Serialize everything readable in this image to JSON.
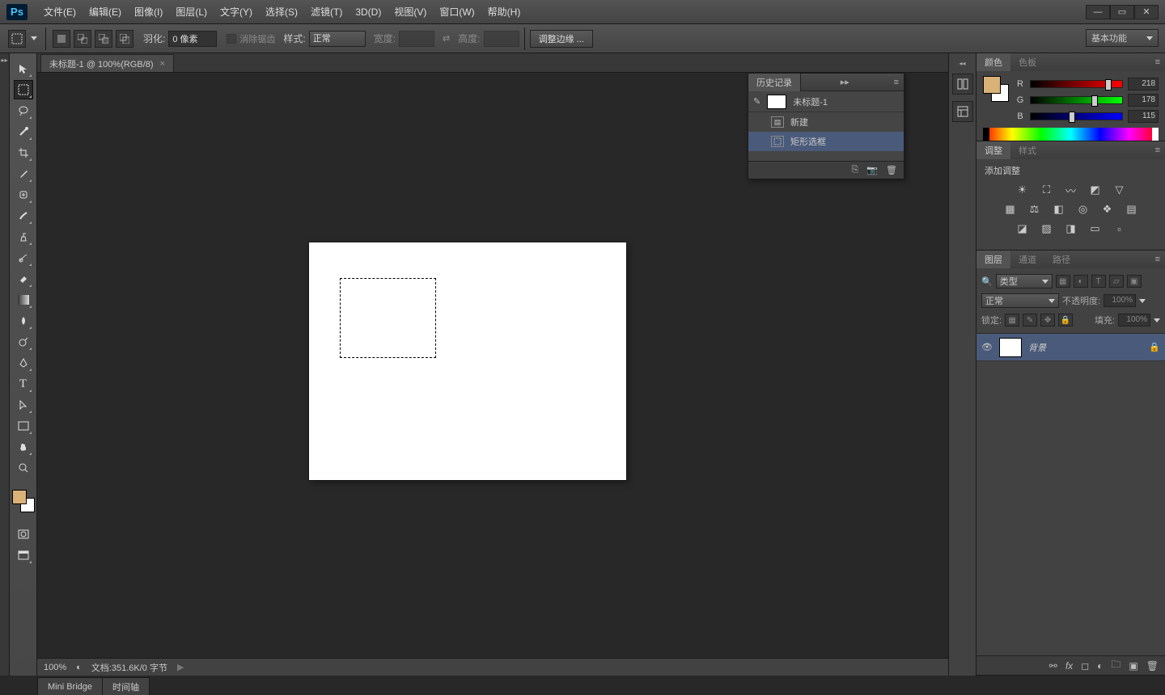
{
  "app": {
    "logo": "Ps"
  },
  "menubar": [
    "文件(E)",
    "编辑(E)",
    "图像(I)",
    "图层(L)",
    "文字(Y)",
    "选择(S)",
    "滤镜(T)",
    "3D(D)",
    "视图(V)",
    "窗口(W)",
    "帮助(H)"
  ],
  "optionsbar": {
    "feather_label": "羽化:",
    "feather_value": "0 像素",
    "antialias": "消除锯齿",
    "style_label": "样式:",
    "style_value": "正常",
    "width_label": "宽度:",
    "height_label": "高度:",
    "refine_edge": "调整边缘 ...",
    "workspace": "基本功能"
  },
  "document": {
    "tab_title": "未标题-1 @ 100%(RGB/8)",
    "zoom": "100%",
    "status": "文档:351.6K/0 字节"
  },
  "history": {
    "title": "历史记录",
    "doc_name": "未标题-1",
    "items": [
      "新建",
      "矩形选框"
    ]
  },
  "color_panel": {
    "tab_color": "颜色",
    "tab_swatch": "色板",
    "r_label": "R",
    "r_val": "218",
    "g_label": "G",
    "g_val": "178",
    "b_label": "B",
    "b_val": "115",
    "fg_hex": "#dab278"
  },
  "adjustments": {
    "tab_adj": "调整",
    "tab_style": "样式",
    "add_label": "添加调整"
  },
  "layers": {
    "tab_layers": "图层",
    "tab_channels": "通道",
    "tab_paths": "路径",
    "filter_label": "类型",
    "blend_mode": "正常",
    "opacity_label": "不透明度:",
    "opacity_val": "100%",
    "lock_label": "锁定:",
    "fill_label": "填充:",
    "fill_val": "100%",
    "bg_layer": "背景"
  },
  "bottom_tabs": [
    "Mini Bridge",
    "时间轴"
  ]
}
